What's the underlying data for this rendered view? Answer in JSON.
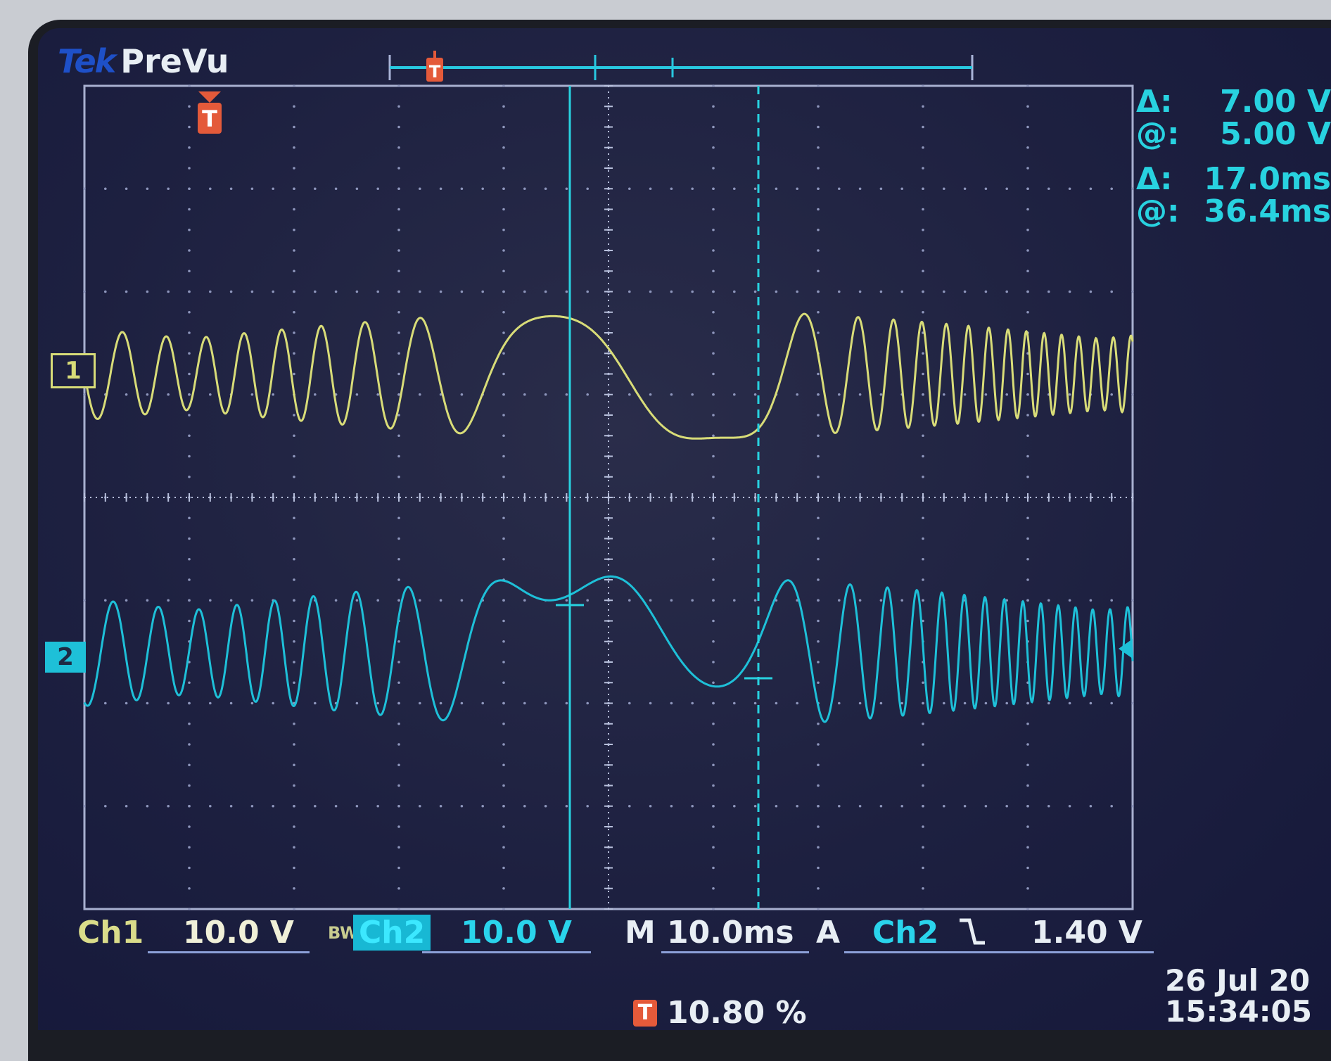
{
  "header": {
    "brand": "Tek",
    "mode": "PreVu"
  },
  "channels": {
    "ch1_marker": "1",
    "ch2_marker": "2"
  },
  "cursor_readouts": [
    {
      "label": "Δ:",
      "value": "7.00 V"
    },
    {
      "label": "@:",
      "value": "5.00 V"
    },
    {
      "label": "Δ:",
      "value": "17.0ms"
    },
    {
      "label": "@:",
      "value": "36.4ms"
    }
  ],
  "status_bar": {
    "ch1_label": "Ch1",
    "ch1_volts_div": "10.0 V",
    "bw_limit": "BW",
    "ch2_label": "Ch2",
    "ch2_volts_div": "10.0 V",
    "m_label": "M",
    "timebase": "10.0ms",
    "a_label": "A",
    "trigger_source": "Ch2",
    "trigger_slope_icon": "falling-edge-icon",
    "trigger_level": "1.40 V"
  },
  "trigger_position": {
    "icon": "T",
    "value": "10.80 %"
  },
  "date_time": {
    "date": "26 Jul  20",
    "time": "15:34:05"
  },
  "colors": {
    "ch1": "#d8dc78",
    "ch2": "#1ec0d8",
    "cursor": "#28d2e0",
    "trigger": "#e45a3a",
    "screen_bg": "#1d2040"
  }
}
